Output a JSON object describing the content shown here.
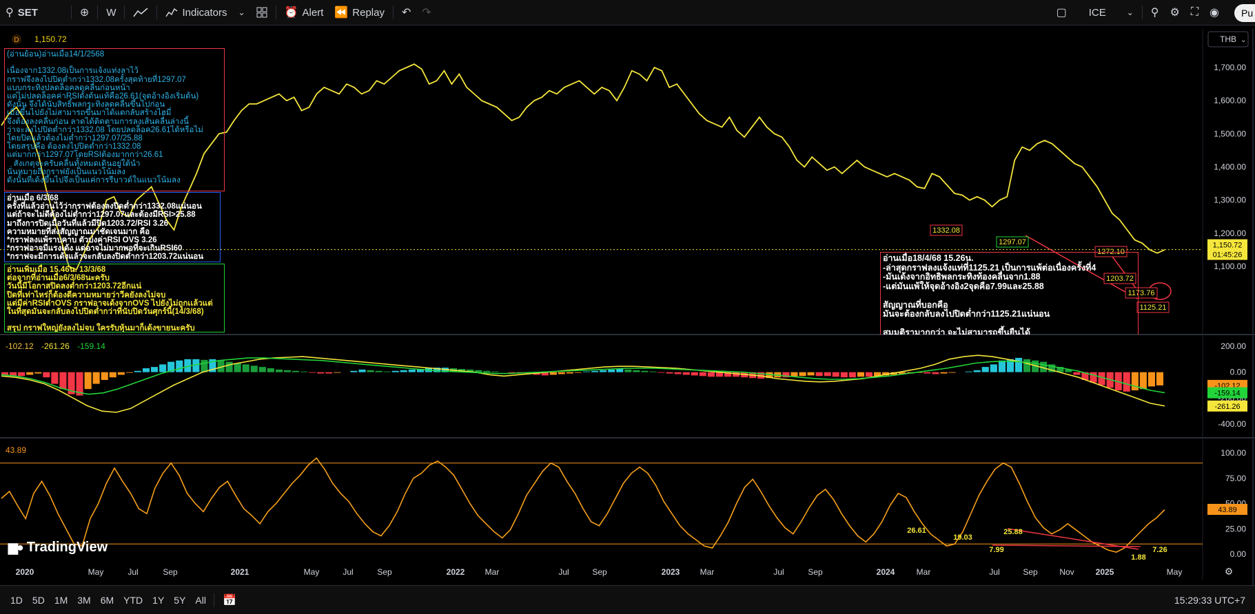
{
  "toolbar": {
    "symbol": "SET",
    "interval": "W",
    "indicators_label": "Indicators",
    "alert_label": "Alert",
    "replay_label": "Replay",
    "exchange": "ICE",
    "publish_label": "Pu"
  },
  "legend": {
    "badge": "D",
    "price": "1,150.72",
    "macd_values": [
      "-102.12",
      "-261.26",
      "-159.14"
    ],
    "rsi_value": "43.89"
  },
  "currency": "THB",
  "price_axis": {
    "labels": [
      "1,700.00",
      "1,600.00",
      "1,500.00",
      "1,400.00",
      "1,300.00",
      "1,200.00",
      "1,100.00"
    ],
    "current": "1,150.72",
    "countdown": "01:45:26"
  },
  "macd_axis": {
    "labels": [
      "200.00",
      "0.00",
      "-200.00",
      "-400.00"
    ],
    "badges": [
      "-102.12",
      "-159.14",
      "-261.26"
    ]
  },
  "rsi_axis": {
    "labels": [
      "100.00",
      "75.00",
      "50.00",
      "25.00",
      "0.00"
    ],
    "badge": "43.89"
  },
  "time_axis": [
    "2020",
    "May",
    "Jul",
    "Sep",
    "2021",
    "May",
    "Jul",
    "Sep",
    "2022",
    "Mar",
    "Jul",
    "Sep",
    "2023",
    "Mar",
    "Jul",
    "Sep",
    "2024",
    "Mar",
    "Jul",
    "Sep",
    "Nov",
    "2025",
    "May"
  ],
  "price_labels": [
    "1332.08",
    "1297.07",
    "1272.10",
    "1203.72",
    "1173.76",
    "1125.21"
  ],
  "rsi_labels": [
    "26.61",
    "19.03",
    "25.88",
    "7.99",
    "1.88",
    "7.26"
  ],
  "notes": {
    "red": "(อ่านย้อน)อ่านเมื่อ14/1/2568\n\nเนื่องจาก1332.08เป็นการแจ้งแท่งลาไว้\nกราฟจึงลงไปปิดต่ำกว่า1332.08ครั้งสุดท้ายที่1297.07\nแบบกระทิงปลดล็อคลดคลื่นก่อนหน้า\nแต่ไม่ปลดล็อคค่าRSIตั้งต้นแท้คือ26.61(จุดอ้างอิงเริ่มต้น)\nดังนั้น จึงได้นับสิทธิ์พลกระทิงลดคลื่นขึ้นไปก่อน\nเมื่อขึ้นไปยังไม่สามารถขึ้นมาได้แตกลับสร้างไฮมี่\nจึงต้องลงคลื่นก่อน ลาดได้ติดตามการลงเส้นคลื่นล่างนี้\nว่าจะลงไปปิดต่ำกว่า1332.08 โดยปลดล็อค26.61ได้หรือไม่\nโดยปิดแล้วต้องไม่ต่ำกว่า1297.07/25.88\nโดยสรุปคือ ต้องลงไปปิดต่ำกว่า1332.08\nแต่มากกว่า1297.07โดยRSIต้องมากกว่า26.61\n   สังเกตุจะครับคลื่นทั้งหมดเดินอยู่ใต้นำ\nนั่นหมายถึงกราฟยังเป็นแนวโน้มลง\nดังนั้นที่เด้งขึ้นไปจึงเป็นแค่การรีบาวด์ในแนวโน้มลง",
    "blue": "อ่านเมื่อ 6/3/68\nครั้งที่แล้วอ่านไว้ว่ากราฟต้องลงปิดต่ำกว่า1332.08แน่นอน\nแต่ถ้าจะไม่ดีต้องไม่ต่ำกว่า1297.07และต้องมีRSI>25.88\nมาถึงการปิดเมื่อวันที่แล้วมีปิด1203.72/RSI 3.26\nความหมายที่ส่งสัญญาณมาชัดเจนมาก คือ\n*กราฟลงแพ้ราบคาบ ตัวบ่งค่าRSI OVS 3.26\n*กราฟอาจมีแรงเด้ง แต่อาจไม่มากพอที่จะเกินRSI60\n*กราฟจะมีการเด้งแล้วจะกลับลงปิดต่ำกว่า1203.72แน่นอน",
    "green": "อ่านเพิ่มเมื่อ 15.46น. 13/3/68\nต่อจากที่อ่านเมื่อ6/3/68นะครับ\nวันนี้มีโอกาสปิดลงต่ำกว่า1203.72อีกแน่\nปิดที่เท่าไหร่ก็ต้องตีความหมายว่าวีคยังลงไม่จบ\nแต่มีค่าRSIต่ำOVS กราฟอาจเด้งจากOVS ไปยังไม่ถูกเเล้วแต่\nในที่สุดมันจะกลับลงไปปิดต่ำกว่าที่นับปิดวันศุกร์นี้(14/3/68)\n\nสรุป กราฟใหญ่ยังลงไม่จบ ใครรับหุ้นมาก็เด้งขายนะครับ",
    "right": "อ่านเมื่อ18/4/68 15.26น.\n-ล่าสุดกราฟลงแจ้งแท่ที่1125.21 เป็นการแพ้ต่อเนื่องครั้งที่4\n-มันเด้งจากอิทธิพลกระทิงท้องคลื่นจาก1.88\n-แต่มันแพ้ให้จุดอ้างอิง2จุดคือ7.99และ25.88\n\nสัญญาณที่บอกคือ\nมันจะต้องกลับลงไปปิดต่ำกว่า1125.21แน่นอน\n\nสมมติรามากกว่า จะไม่สามารถขึ้นยืนได้"
  },
  "timeframes": [
    "1D",
    "5D",
    "1M",
    "3M",
    "6M",
    "YTD",
    "1Y",
    "5Y",
    "All"
  ],
  "clock": "15:29:33 UTC+7",
  "watermark": "TradingView",
  "chart_data": [
    {
      "type": "line",
      "title": "SET",
      "series": [
        {
          "name": "SET",
          "values": [
            1525,
            1560,
            1580,
            1545,
            1500,
            1430,
            1330,
            1250,
            1175,
            1100,
            1090,
            1140,
            1190,
            1220,
            1300,
            1310,
            1260,
            1250,
            1300,
            1320,
            1340,
            1290,
            1240,
            1210,
            1280,
            1330,
            1380,
            1440,
            1470,
            1500,
            1505,
            1540,
            1570,
            1590,
            1590,
            1600,
            1610,
            1620,
            1600,
            1610,
            1570,
            1580,
            1620,
            1640,
            1630,
            1620,
            1650,
            1640,
            1620,
            1630,
            1660,
            1650,
            1670,
            1690,
            1700,
            1710,
            1695,
            1650,
            1660,
            1690,
            1650,
            1680,
            1640,
            1620,
            1600,
            1590,
            1580,
            1560,
            1540,
            1550,
            1580,
            1600,
            1610,
            1630,
            1620,
            1640,
            1650,
            1660,
            1640,
            1620,
            1640,
            1630,
            1600,
            1640,
            1690,
            1680,
            1660,
            1700,
            1690,
            1640,
            1650,
            1620,
            1590,
            1560,
            1540,
            1530,
            1520,
            1550,
            1510,
            1490,
            1520,
            1550,
            1520,
            1500,
            1490,
            1460,
            1420,
            1400,
            1430,
            1410,
            1390,
            1400,
            1380,
            1400,
            1420,
            1400,
            1390,
            1380,
            1370,
            1380,
            1370,
            1360,
            1340,
            1335,
            1380,
            1370,
            1345,
            1320,
            1315,
            1300,
            1310,
            1300,
            1280,
            1300,
            1310,
            1420,
            1460,
            1450,
            1470,
            1480,
            1470,
            1450,
            1430,
            1410,
            1400,
            1370,
            1340,
            1300,
            1260,
            1240,
            1210,
            1180,
            1170,
            1150,
            1140,
            1150
          ]
        }
      ],
      "ylim": [
        1100,
        1720
      ],
      "price_markers": [
        1332.08,
        1297.07,
        1272.1,
        1203.72,
        1173.76,
        1125.21
      ],
      "current": 1150.72
    },
    {
      "type": "bar",
      "title": "MACD",
      "series": [
        {
          "name": "histogram",
          "values": [
            -20,
            -25,
            -30,
            -20,
            -10,
            -40,
            -90,
            -130,
            -170,
            -180,
            -130,
            -90,
            -60,
            -40,
            -20,
            -5,
            10,
            30,
            40,
            60,
            80,
            90,
            100,
            100,
            95,
            100,
            90,
            80,
            70,
            60,
            50,
            40,
            30,
            20,
            15,
            10,
            5,
            -5,
            -10,
            -10,
            -5,
            0,
            10,
            20,
            15,
            10,
            5,
            10,
            15,
            20,
            25,
            30,
            35,
            35,
            30,
            25,
            20,
            15,
            10,
            5,
            0,
            -5,
            -10,
            -15,
            -20,
            -25,
            -20,
            -15,
            -10,
            -5,
            5,
            10,
            15,
            20,
            25,
            20,
            15,
            10,
            5,
            -5,
            -10,
            -15,
            -20,
            -25,
            -30,
            -35,
            -35,
            -35,
            -35,
            -40,
            -45,
            -50,
            -45,
            -40,
            -40,
            -35,
            -30,
            -25,
            -30,
            -30,
            -35,
            -40,
            -40,
            -35,
            -35,
            -30,
            -25,
            -20,
            -15,
            -10,
            -5,
            -10,
            -15,
            -10,
            -5,
            0,
            5,
            15,
            40,
            60,
            90,
            100,
            110,
            100,
            90,
            80,
            60,
            40,
            20,
            -20,
            -60,
            -80,
            -100,
            -120,
            -140,
            -150,
            -140,
            -130,
            -110,
            -102
          ]
        },
        {
          "name": "macd",
          "values": [
            -30,
            -40,
            -60,
            -90,
            -140,
            -200,
            -260,
            -300,
            -310,
            -280,
            -220,
            -160,
            -100,
            -50,
            0,
            30,
            60,
            80,
            100,
            110,
            115,
            120,
            110,
            100,
            90,
            80,
            70,
            60,
            50,
            40,
            30,
            20,
            10,
            0,
            -20,
            -30,
            -20,
            -10,
            0,
            10,
            20,
            30,
            40,
            45,
            45,
            40,
            35,
            30,
            20,
            10,
            0,
            -10,
            -20,
            -30,
            -50,
            -60,
            -70,
            -75,
            -70,
            -60,
            -50,
            -30,
            -10,
            10,
            30,
            60,
            100,
            120,
            130,
            120,
            100,
            80,
            50,
            20,
            -10,
            -40,
            -80,
            -120,
            -160,
            -200,
            -240,
            -261
          ]
        },
        {
          "name": "signal",
          "values": [
            -20,
            -30,
            -50,
            -80,
            -120,
            -150,
            -170,
            -160,
            -130,
            -90,
            -50,
            -10,
            20,
            50,
            70,
            90,
            100,
            110,
            110,
            105,
            100,
            95,
            90,
            80,
            70,
            60,
            50,
            40,
            30,
            20,
            10,
            5,
            0,
            -5,
            -10,
            -10,
            -5,
            0,
            5,
            10,
            15,
            20,
            25,
            30,
            30,
            30,
            25,
            20,
            15,
            10,
            5,
            0,
            -10,
            -20,
            -30,
            -40,
            -50,
            -55,
            -55,
            -50,
            -40,
            -30,
            -15,
            0,
            15,
            30,
            50,
            70,
            80,
            85,
            80,
            70,
            50,
            30,
            10,
            -20,
            -50,
            -80,
            -110,
            -140,
            -159
          ]
        }
      ],
      "ylim": [
        -420,
        220
      ]
    },
    {
      "type": "line",
      "title": "RSI",
      "series": [
        {
          "name": "RSI",
          "values": [
            55,
            62,
            48,
            35,
            60,
            72,
            58,
            40,
            25,
            10,
            8,
            35,
            50,
            70,
            85,
            72,
            60,
            45,
            40,
            65,
            80,
            90,
            78,
            60,
            50,
            42,
            55,
            66,
            72,
            58,
            45,
            38,
            30,
            42,
            50,
            60,
            70,
            78,
            88,
            95,
            84,
            70,
            60,
            52,
            40,
            30,
            22,
            18,
            28,
            42,
            60,
            75,
            80,
            88,
            92,
            86,
            78,
            64,
            50,
            38,
            30,
            22,
            16,
            24,
            40,
            58,
            70,
            82,
            90,
            86,
            72,
            60,
            45,
            32,
            28,
            40,
            55,
            70,
            80,
            86,
            80,
            68,
            52,
            40,
            28,
            20,
            14,
            8,
            6,
            18,
            32,
            50,
            66,
            74,
            62,
            48,
            36,
            26,
            20,
            32,
            46,
            58,
            64,
            54,
            40,
            28,
            18,
            12,
            20,
            32,
            48,
            60,
            56,
            42,
            30,
            20,
            14,
            8,
            10,
            22,
            40,
            58,
            72,
            84,
            90,
            86,
            70,
            52,
            36,
            26,
            20,
            24,
            30,
            24,
            18,
            12,
            8,
            4,
            2,
            6,
            14,
            22,
            30,
            36,
            43.89
          ]
        }
      ],
      "ylim": [
        0,
        100
      ],
      "levels": [
        90,
        10
      ]
    }
  ]
}
